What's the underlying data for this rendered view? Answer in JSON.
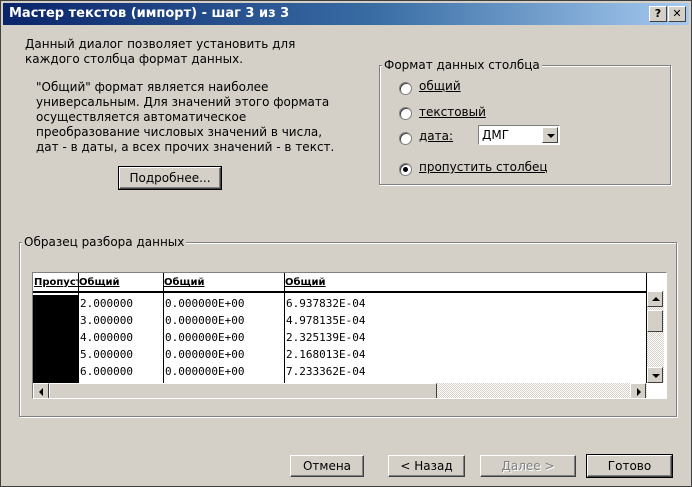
{
  "window": {
    "title": "Мастер текстов (импорт) - шаг 3 из 3",
    "help_label": "?",
    "close_label": "✕"
  },
  "intro": {
    "line1": "Данный диалог позволяет установить для",
    "line2": "каждого столбца формат данных.",
    "general_info": [
      "\"Общий\" формат является наиболее",
      "универсальным. Для значений этого формата",
      "осуществляется автоматическое",
      "преобразование числовых значений в числа,",
      "дат - в даты, а всех прочих значений - в текст."
    ]
  },
  "details_button": "Подробнее...",
  "format_group": {
    "legend": "Формат данных столбца",
    "options": [
      {
        "label": "общий",
        "selected": false
      },
      {
        "label": "текстовый",
        "selected": false
      },
      {
        "label": "дата:",
        "selected": false
      },
      {
        "label": "пропустить столбец",
        "selected": true
      }
    ],
    "date_format": "ДМГ"
  },
  "preview": {
    "legend": "Образец разбора данных",
    "headers": [
      "Пропустить",
      "Общий",
      "Общий",
      "Общий"
    ],
    "rows": [
      [
        "",
        "2.000000",
        "0.000000E+00",
        "6.937832E-04"
      ],
      [
        "",
        "3.000000",
        "0.000000E+00",
        "4.978135E-04"
      ],
      [
        "",
        "4.000000",
        "0.000000E+00",
        "2.325139E-04"
      ],
      [
        "",
        "5.000000",
        "0.000000E+00",
        "2.168013E-04"
      ],
      [
        "",
        "6.000000",
        "0.000000E+00",
        "7.233362E-04"
      ]
    ]
  },
  "buttons": {
    "cancel": "Отмена",
    "back": "< Назад",
    "next": "Далее >",
    "finish": "Готово"
  },
  "colors": {
    "title_start": "#0a246a",
    "title_end": "#a6caf0",
    "face": "#d4d0c8",
    "skipped_column": "#000000"
  }
}
